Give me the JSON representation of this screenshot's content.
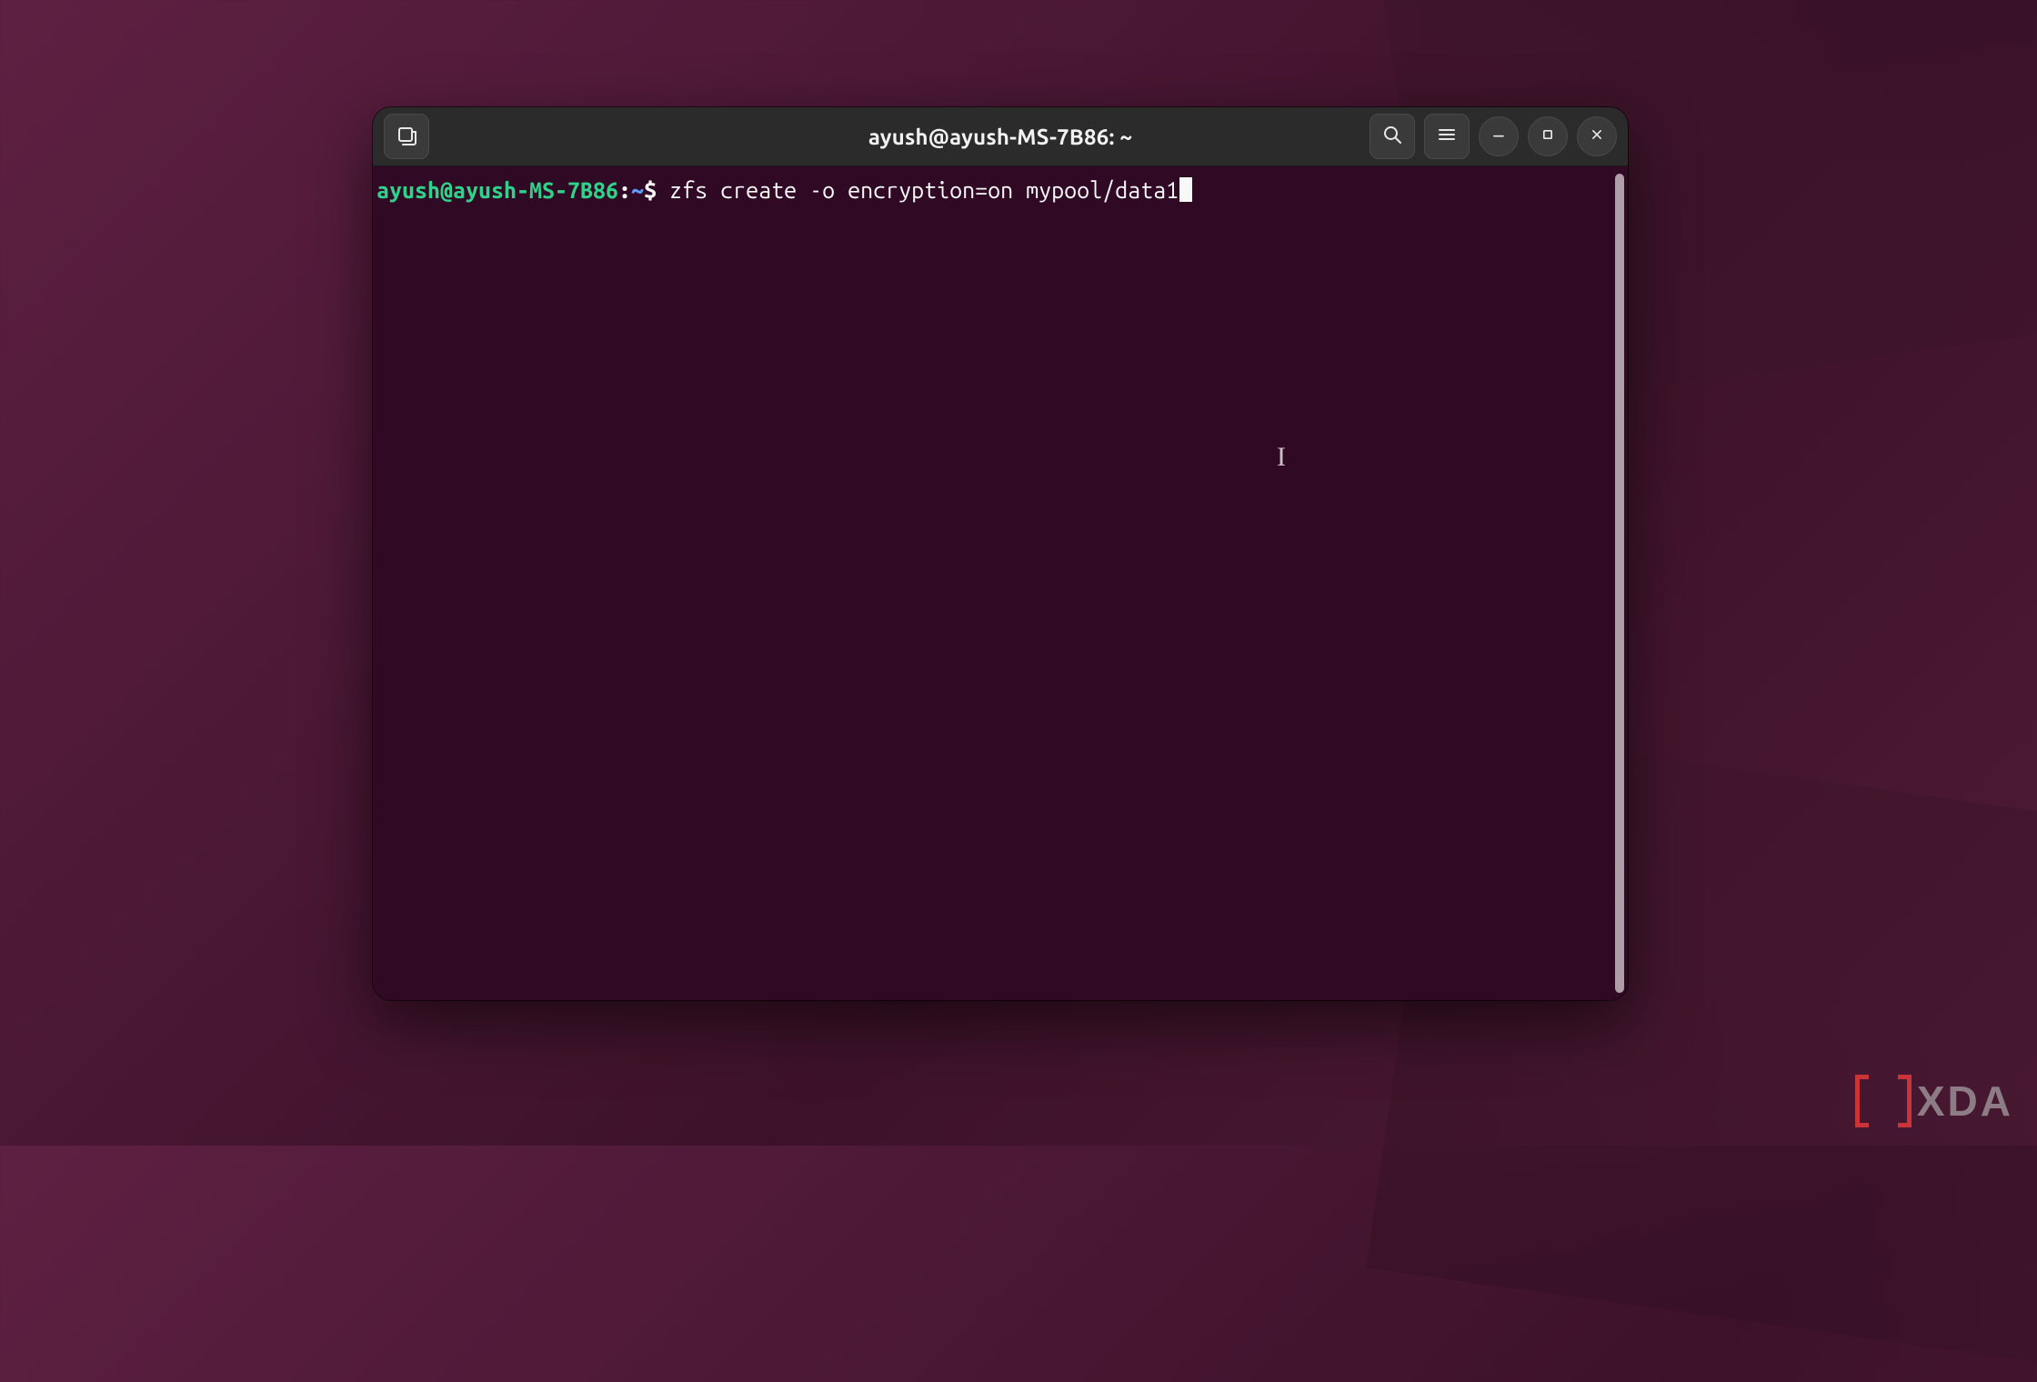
{
  "window": {
    "title": "ayush@ayush-MS-7B86: ~"
  },
  "terminal": {
    "prompt_user_host": "ayush@ayush-MS-7B86",
    "prompt_sep1": ":",
    "prompt_path": "~",
    "prompt_sep2": "$",
    "command": " zfs create -o encryption=on mypool/data1"
  },
  "titlebar": {
    "icons": {
      "new_tab": "new-tab-icon",
      "search": "search-icon",
      "menu": "hamburger-icon",
      "minimize": "minimize-icon",
      "maximize": "maximize-icon",
      "close": "close-icon"
    }
  },
  "watermark": {
    "text": "XDA"
  },
  "colors": {
    "terminal_bg": "#300a24",
    "prompt_green": "#2fd18b",
    "prompt_blue": "#5c9dff",
    "text": "#f8f8f8",
    "titlebar_bg": "#2b2b2b",
    "accent_red": "#e03a3a"
  }
}
